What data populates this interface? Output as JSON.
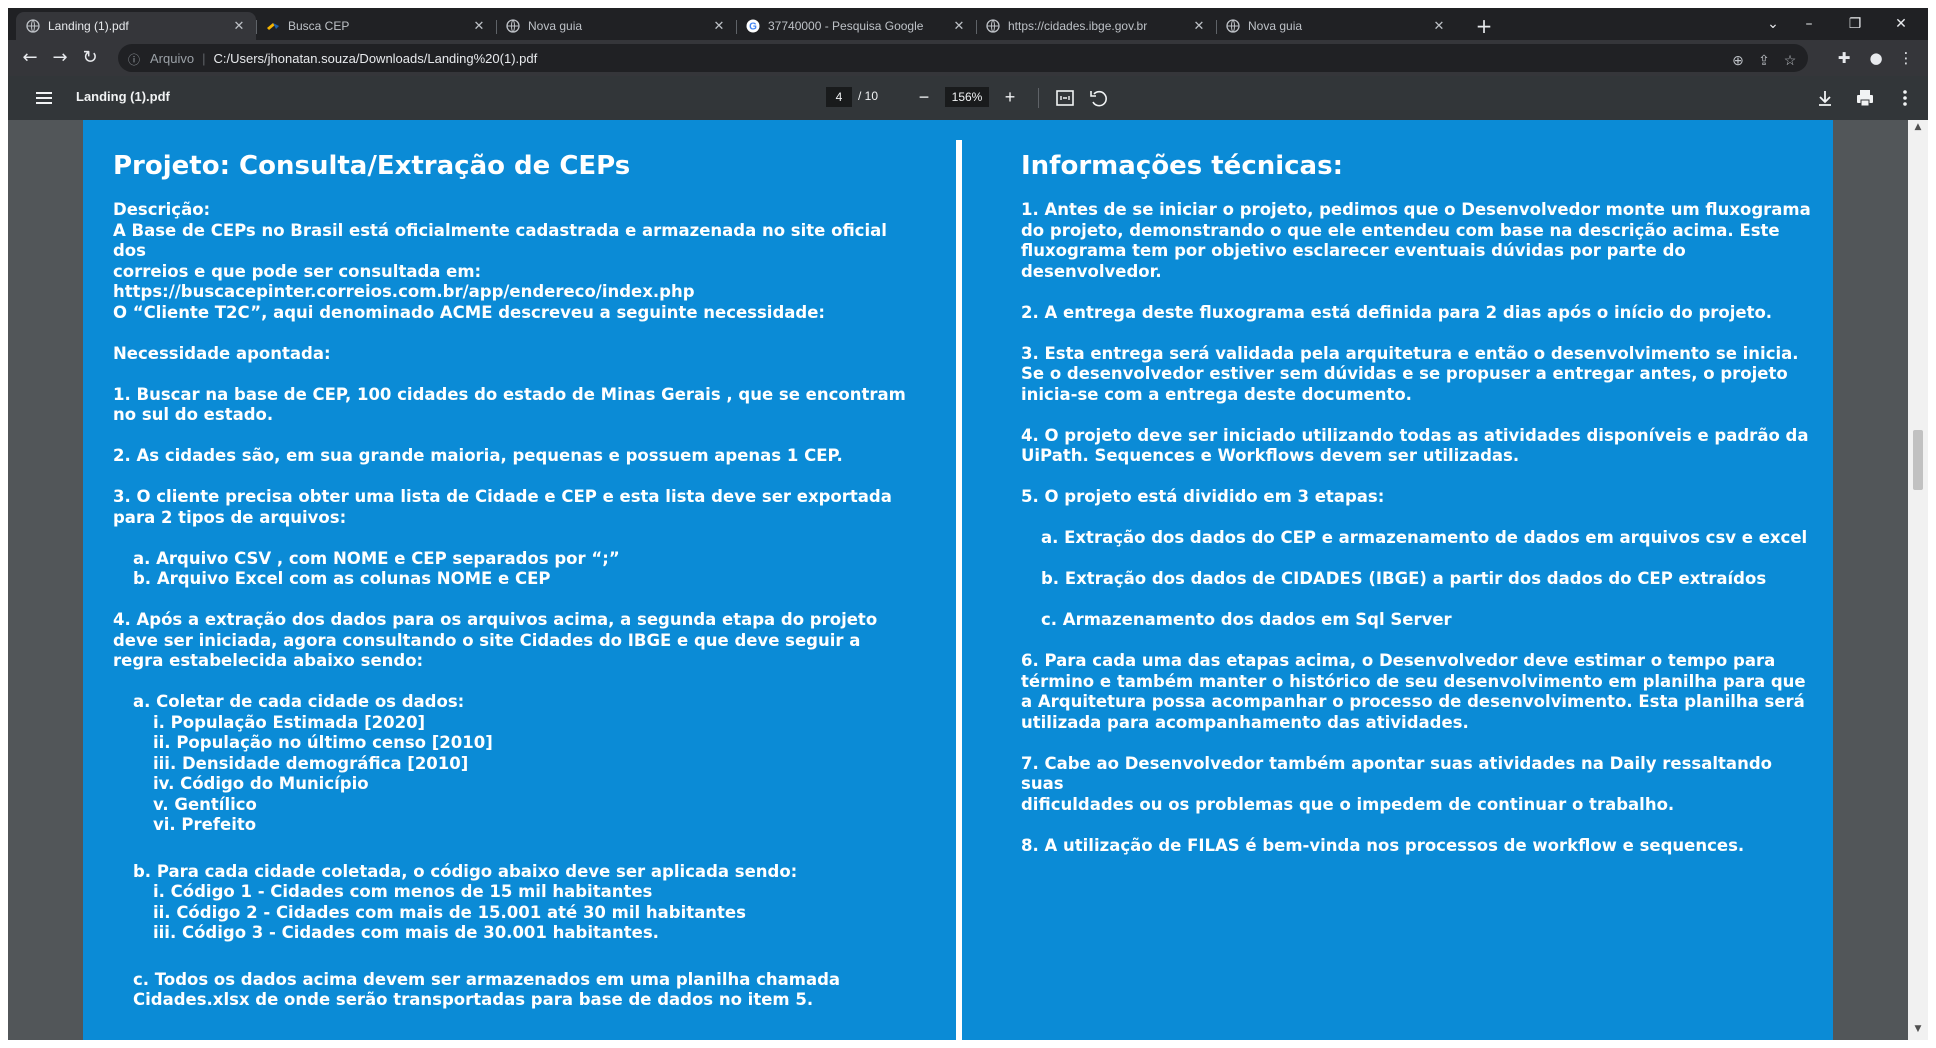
{
  "browser": {
    "tabs": [
      {
        "title": "Landing (1).pdf",
        "icon": "globe-icon",
        "active": true
      },
      {
        "title": "Busca CEP",
        "icon": "correios-icon",
        "active": false
      },
      {
        "title": "Nova guia",
        "icon": "globe-icon",
        "active": false
      },
      {
        "title": "37740000 - Pesquisa Google",
        "icon": "google-icon",
        "active": false
      },
      {
        "title": "https://cidades.ibge.gov.br",
        "icon": "globe-icon",
        "active": false
      },
      {
        "title": "Nova guia",
        "icon": "globe-icon",
        "active": false
      }
    ],
    "address": {
      "label": "Arquivo",
      "url": "C:/Users/jhonatan.souza/Downloads/Landing%20(1).pdf"
    }
  },
  "pdf": {
    "title": "Landing (1).pdf",
    "page_current": "4",
    "page_total": "/ 10",
    "zoom": "156%"
  },
  "slide": {
    "left": {
      "title": "Projeto: Consulta/Extração de CEPs",
      "desc_label": "Descrição:",
      "desc_1": "A Base de CEPs no Brasil está oficialmente cadastrada e armazenada no site oficial",
      "desc_2": "dos",
      "desc_3": "correios e que pode ser consultada em:",
      "desc_4": "https://buscacepinter.correios.com.br/app/endereco/index.php",
      "desc_5": "O “Cliente T2C”, aqui denominado ACME descreveu a seguinte necessidade:",
      "need_label": "Necessidade apontada:",
      "item1": "1. Buscar na base de CEP, 100 cidades do estado de Minas Gerais , que se encontram\nno sul do estado.",
      "item2": "2. As cidades são, em sua grande maioria, pequenas e possuem apenas 1 CEP.",
      "item3": "3. O cliente precisa obter uma lista de Cidade e CEP e esta lista deve ser exportada\npara 2 tipos de arquivos:",
      "item3a": "a. Arquivo CSV , com NOME e CEP separados por “;”",
      "item3b": "b. Arquivo Excel com as colunas NOME e CEP",
      "item4": "4. Após a extração dos dados para os arquivos acima, a segunda etapa do projeto\ndeve ser iniciada, agora consultando o site Cidades do IBGE e que deve seguir a\nregra estabelecida abaixo sendo:",
      "item4a": "a. Coletar de cada cidade os dados:",
      "item4a_i": "i. População Estimada [2020]",
      "item4a_ii": "ii. População no último censo [2010]",
      "item4a_iii": "iii. Densidade demográfica [2010]",
      "item4a_iv": "iv. Código do Município",
      "item4a_v": "v. Gentílico",
      "item4a_vi": "vi. Prefeito",
      "item4b": "b. Para cada cidade coletada, o código abaixo deve ser aplicada sendo:",
      "item4b_i": "i. Código 1 - Cidades com menos de 15 mil habitantes",
      "item4b_ii": "ii. Código 2 - Cidades com mais de 15.001 até 30 mil habitantes",
      "item4b_iii": "iii. Código 3 - Cidades com mais de 30.001 habitantes.",
      "item4c": "c. Todos os dados acima devem ser armazenados em uma planilha chamada\nCidades.xlsx de onde serão transportadas para base de dados no item 5."
    },
    "right": {
      "title": "Informações técnicas:",
      "r1": "1. Antes de se iniciar o projeto, pedimos que o Desenvolvedor monte um fluxograma\ndo projeto, demonstrando o que ele entendeu com base na descrição acima. Este\nfluxograma tem por objetivo esclarecer eventuais dúvidas por parte do\ndesenvolvedor.",
      "r2": "2. A entrega deste fluxograma está definida para 2 dias após o início do projeto.",
      "r3": "3. Esta entrega será validada pela arquitetura e então o desenvolvimento se inicia.\nSe o desenvolvedor estiver sem dúvidas e se propuser a entregar antes, o projeto\ninicia-se com a entrega deste documento.",
      "r4": "4. O projeto deve ser iniciado utilizando todas as atividades disponíveis e padrão da\nUiPath. Sequences e Workflows devem ser utilizadas.",
      "r5": "5. O projeto está dividido em 3 etapas:",
      "r5a": "a. Extração dos dados do CEP e armazenamento de dados em arquivos csv e excel",
      "r5b": "b. Extração dos dados de CIDADES (IBGE) a partir dos dados do CEP extraídos",
      "r5c": "c. Armazenamento dos dados em Sql Server",
      "r6": "6. Para cada uma das etapas acima, o Desenvolvedor deve estimar o tempo para\ntérmino e também manter o histórico de seu desenvolvimento em planilha para que\na Arquitetura possa acompanhar o processo de desenvolvimento. Esta planilha será\nutilizada para acompanhamento das atividades.",
      "r7": "7. Cabe ao Desenvolvedor também apontar suas atividades na Daily ressaltando suas\ndificuldades ou os problemas que o impedem de continuar o trabalho.",
      "r8": "8. A utilização de FILAS é bem-vinda nos processos de workflow e sequences."
    }
  },
  "colors": {
    "slide_background": "#0b8bd6",
    "viewer_background": "#525659",
    "browser_chrome": "#202124"
  }
}
